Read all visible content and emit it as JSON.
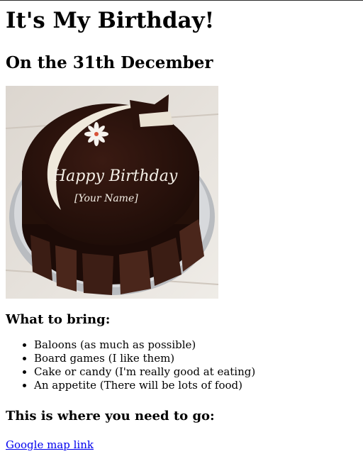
{
  "heading": "It's My Birthday!",
  "date_heading": "On the 31th December",
  "cake": {
    "line1": "Happy Birthday",
    "line2": "[Your Name]"
  },
  "bring": {
    "title": "What to bring:",
    "items": [
      "Baloons (as much as possible)",
      "Board games (I like them)",
      "Cake or candy (I'm really good at eating)",
      "An appetite (There will be lots of food)"
    ]
  },
  "where": {
    "title": "This is where you need to go:",
    "link_text": "Google map link"
  },
  "colors": {
    "link": "#0000ee",
    "chocolate": "#2a120c"
  }
}
